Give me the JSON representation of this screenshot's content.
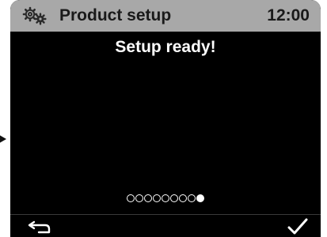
{
  "header": {
    "icon": "settings-gears-icon",
    "title": "Product setup",
    "time": "12:00"
  },
  "content": {
    "message": "Setup ready!"
  },
  "pager": {
    "total_steps": 9,
    "current_step": 9
  },
  "footer": {
    "back_icon": "back-arrow-icon",
    "confirm_icon": "checkmark-icon"
  },
  "colors": {
    "screen_background": "#000000",
    "title_bar": "#a8a8a8",
    "text_primary": "#ffffff",
    "title_text": "#1a1a1a"
  }
}
